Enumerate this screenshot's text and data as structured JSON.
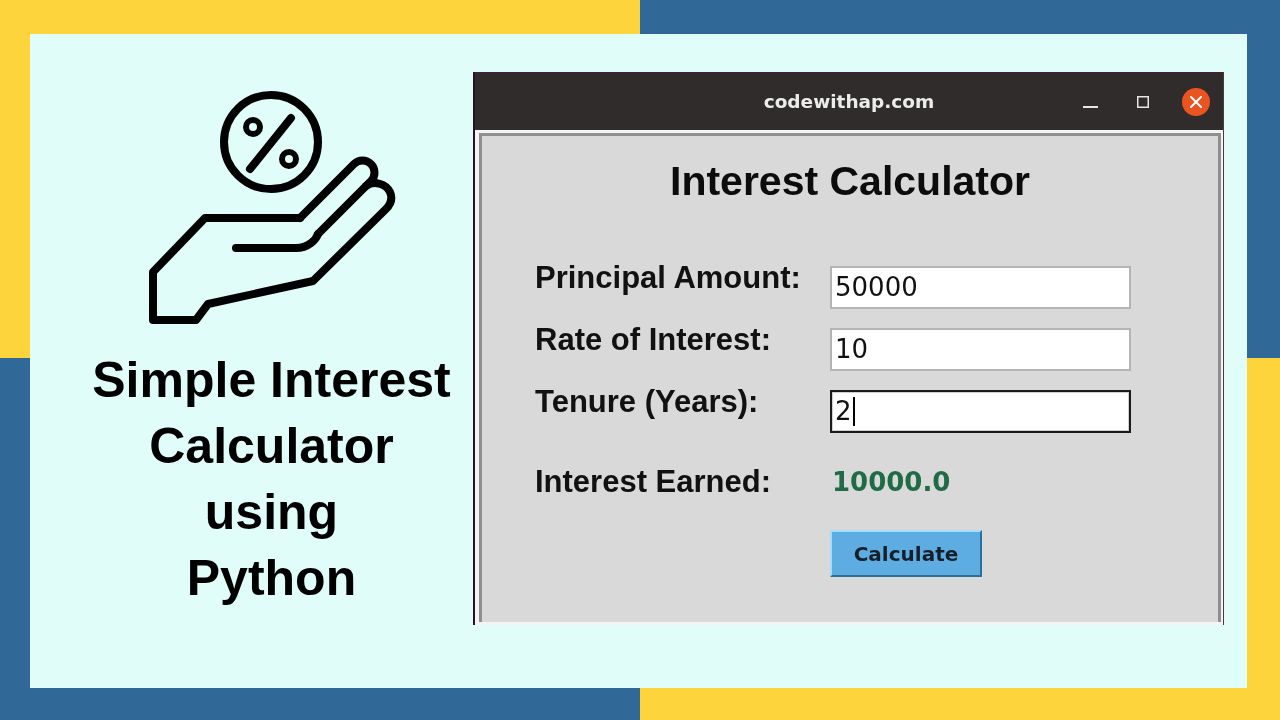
{
  "banner": {
    "headline": "Simple Interest\nCalculator\nusing\nPython"
  },
  "window": {
    "title": "codewithap.com",
    "heading": "Interest Calculator",
    "fields": [
      {
        "label": "Principal Amount:",
        "value": "50000",
        "focused": false
      },
      {
        "label": "Rate of Interest:",
        "value": "10",
        "focused": false
      },
      {
        "label": "Tenure (Years):",
        "value": "2",
        "focused": true
      }
    ],
    "result": {
      "label": "Interest Earned:",
      "value": "10000.0"
    },
    "button": "Calculate"
  }
}
